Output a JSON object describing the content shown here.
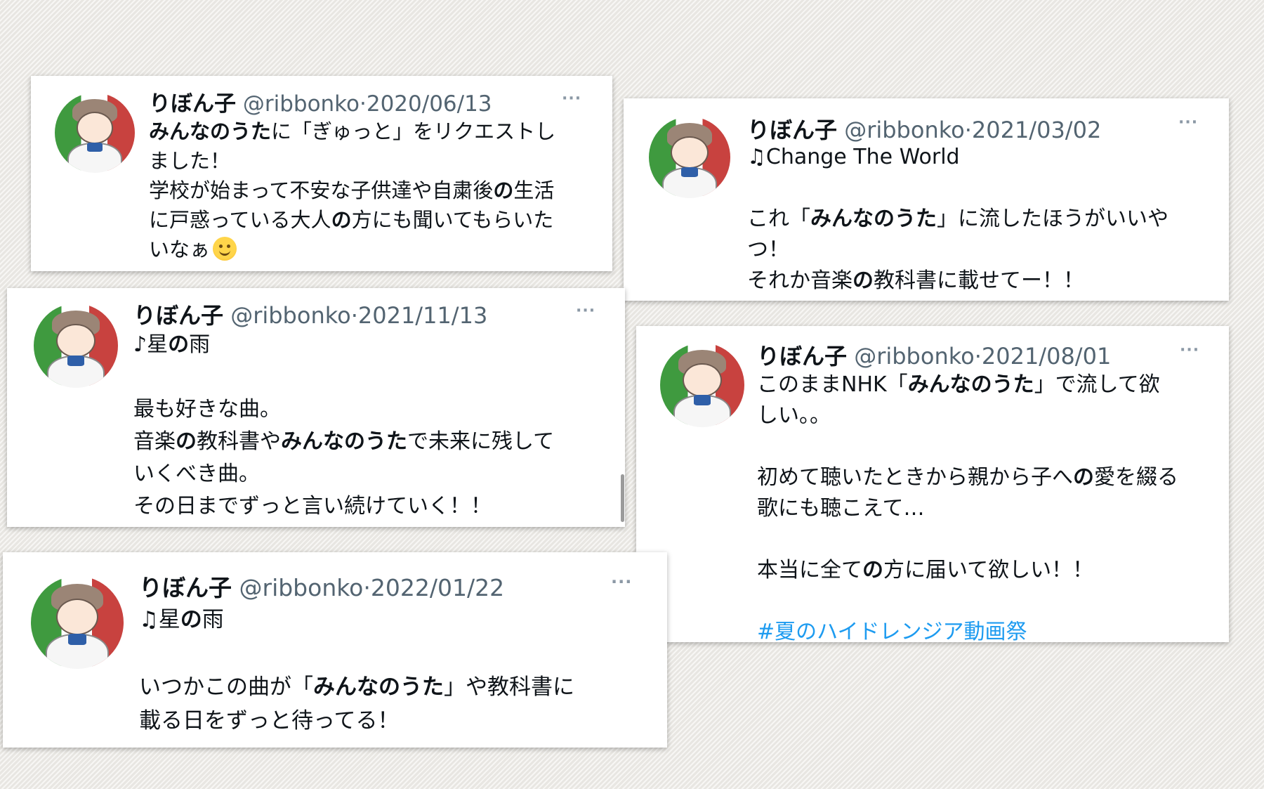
{
  "tweets": [
    {
      "name": "りぼん子",
      "handle": "@ribbonko",
      "separator": "·",
      "date": "2020/06/13",
      "more": "···",
      "lines": [
        [
          {
            "t": "みんなのうた",
            "b": true
          },
          {
            "t": "に「ぎゅっと」をリクエストし"
          }
        ],
        [
          {
            "t": "ました！"
          }
        ],
        [
          {
            "t": "学校が始まって不安な子供達や自粛後"
          },
          {
            "t": "の",
            "b": true
          },
          {
            "t": "生活"
          }
        ],
        [
          {
            "t": "に戸惑っている大人"
          },
          {
            "t": "の",
            "b": true
          },
          {
            "t": "方にも聞いてもらいた"
          }
        ],
        [
          {
            "t": "いなぁ"
          },
          {
            "emoji": "smiling-face-icon"
          }
        ]
      ]
    },
    {
      "name": "りぼん子",
      "handle": "@ribbonko",
      "separator": "·",
      "date": "2021/03/02",
      "more": "···",
      "lines": [
        [
          {
            "t": "♫Change The World"
          }
        ],
        [],
        [
          {
            "t": "これ「"
          },
          {
            "t": "みんなのうた",
            "b": true
          },
          {
            "t": "」に流したほうがいいや"
          }
        ],
        [
          {
            "t": "つ！"
          }
        ],
        [
          {
            "t": "それか音楽"
          },
          {
            "t": "の",
            "b": true
          },
          {
            "t": "教科書に載せてー！！"
          }
        ]
      ]
    },
    {
      "name": "りぼん子",
      "handle": "@ribbonko",
      "separator": "·",
      "date": "2021/11/13",
      "more": "···",
      "lines": [
        [
          {
            "t": "♪星"
          },
          {
            "t": "の",
            "b": true
          },
          {
            "t": "雨"
          }
        ],
        [],
        [
          {
            "t": "最も好きな曲。"
          }
        ],
        [
          {
            "t": "音楽"
          },
          {
            "t": "の",
            "b": true
          },
          {
            "t": "教科書や"
          },
          {
            "t": "みんなのうた",
            "b": true
          },
          {
            "t": "で未来に残して"
          }
        ],
        [
          {
            "t": "いくべき曲。"
          }
        ],
        [
          {
            "t": "その日までずっと言い続けていく！！"
          }
        ]
      ]
    },
    {
      "name": "りぼん子",
      "handle": "@ribbonko",
      "separator": "·",
      "date": "2021/08/01",
      "more": "···",
      "lines": [
        [
          {
            "t": "このままNHK「"
          },
          {
            "t": "みんなのうた",
            "b": true
          },
          {
            "t": "」で流して欲"
          }
        ],
        [
          {
            "t": "しい。。"
          }
        ],
        [],
        [
          {
            "t": "初めて聴いたときから親から子へ"
          },
          {
            "t": "の",
            "b": true
          },
          {
            "t": "愛を綴る"
          }
        ],
        [
          {
            "t": "歌にも聴こえて…"
          }
        ],
        [],
        [
          {
            "t": "本当に全て"
          },
          {
            "t": "の",
            "b": true
          },
          {
            "t": "方に届いて欲しい！！"
          }
        ],
        [],
        [
          {
            "t": "#夏のハイドレンジア動画祭",
            "hashtag": true
          }
        ]
      ]
    },
    {
      "name": "りぼん子",
      "handle": "@ribbonko",
      "separator": "·",
      "date": "2022/01/22",
      "more": "···",
      "lines": [
        [
          {
            "t": "♫星"
          },
          {
            "t": "の",
            "b": true
          },
          {
            "t": "雨"
          }
        ],
        [],
        [
          {
            "t": "いつかこの曲が「"
          },
          {
            "t": "みんなのうた",
            "b": true
          },
          {
            "t": "」や教科書に"
          }
        ],
        [
          {
            "t": "載る日をずっと待ってる！"
          }
        ]
      ]
    }
  ]
}
